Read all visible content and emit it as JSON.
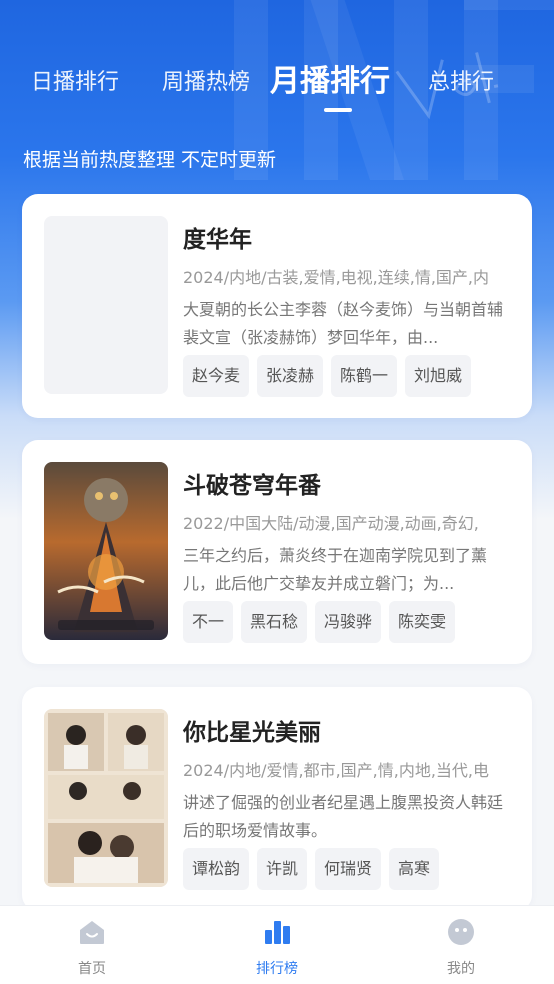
{
  "tabs": [
    {
      "label": "日播排行"
    },
    {
      "label": "周播热榜"
    },
    {
      "label": "月播排行",
      "active": true
    },
    {
      "label": "总排行"
    }
  ],
  "subtitle": "根据当前热度整理 不定时更新",
  "colors": {
    "accent": "#2f7cf0",
    "hero_top": "#1f66e0",
    "card_bg": "#ffffff",
    "tag_bg": "#f2f3f6"
  },
  "cards": [
    {
      "title": "度华年",
      "meta": "2024/内地/古装,爱情,电视,连续,情,国产,内",
      "desc": "大夏朝的长公主李蓉（赵今麦饰）与当朝首辅裴文宣（张凌赫饰）梦回华年，由...",
      "tags": [
        "赵今麦",
        "张凌赫",
        "陈鹤一",
        "刘旭威"
      ],
      "poster": "placeholder"
    },
    {
      "title": "斗破苍穹年番",
      "meta": "2022/中国大陆/动漫,国产动漫,动画,奇幻,",
      "desc": "三年之约后，萧炎终于在迦南学院见到了薰儿，此后他广交挚友并成立磐门；为...",
      "tags": [
        "不一",
        "黑石稔",
        "冯骏骅",
        "陈奕雯"
      ],
      "poster": "anime-poster"
    },
    {
      "title": "你比星光美丽",
      "meta": "2024/内地/爱情,都市,国产,情,内地,当代,电",
      "desc": "讲述了倔强的创业者纪星遇上腹黑投资人韩廷后的职场爱情故事。",
      "tags": [
        "谭松韵",
        "许凯",
        "何瑞贤",
        "高寒"
      ],
      "poster": "drama-poster"
    }
  ],
  "nav": [
    {
      "label": "首页",
      "icon": "home-icon"
    },
    {
      "label": "排行榜",
      "icon": "chart-icon",
      "active": true
    },
    {
      "label": "我的",
      "icon": "profile-icon"
    }
  ]
}
